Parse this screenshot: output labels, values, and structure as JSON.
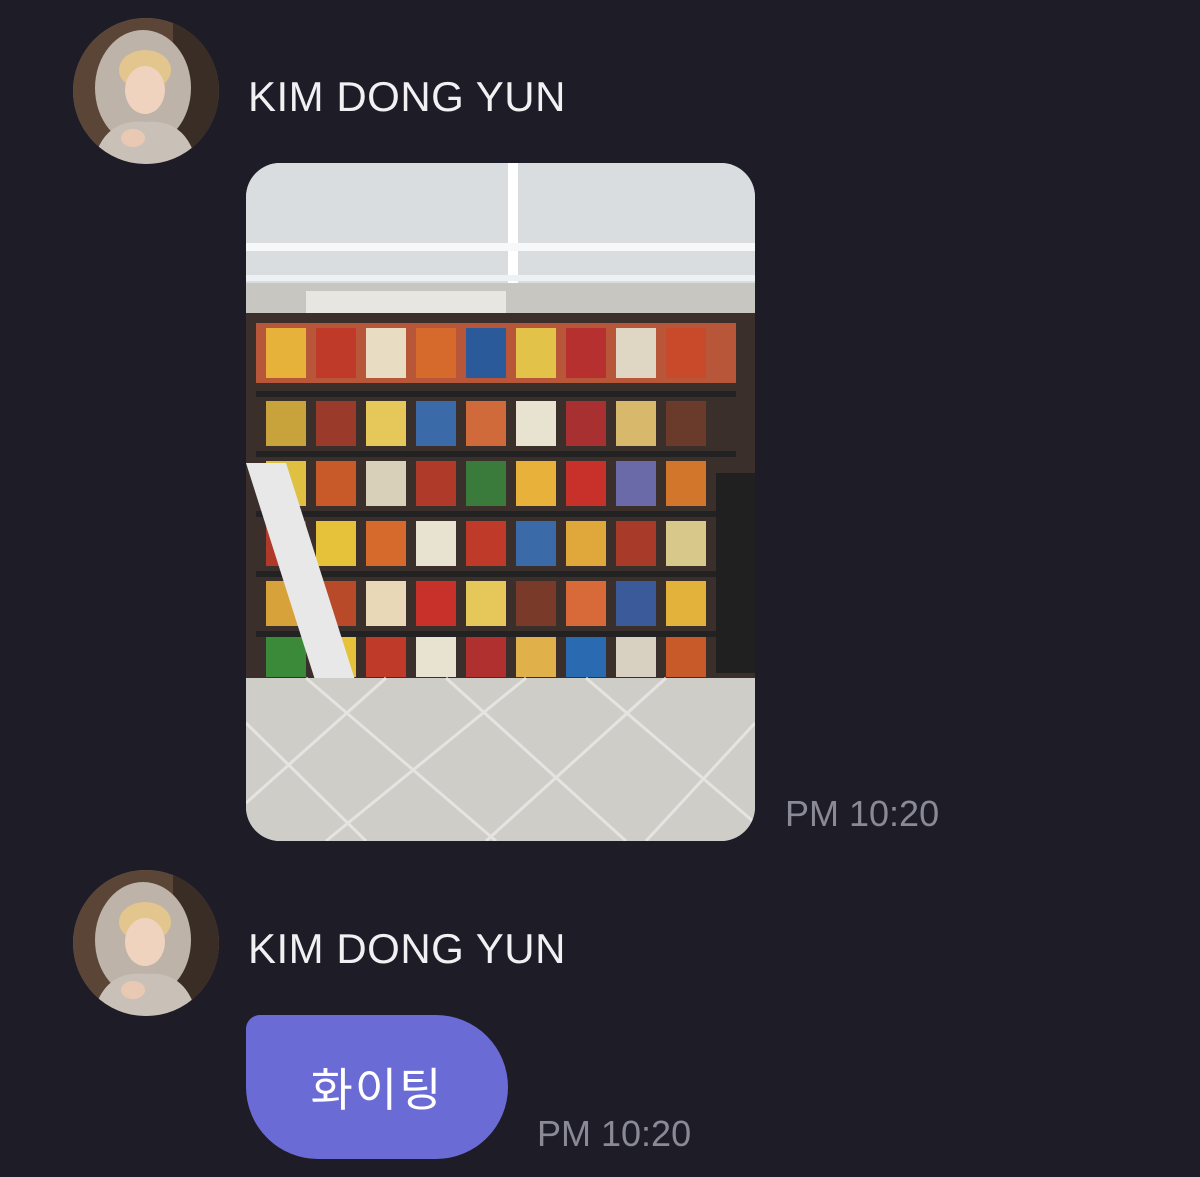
{
  "messages": [
    {
      "sender": "KIM DONG YUN",
      "type": "image",
      "image_icon": "photo-convenience-store-snack-shelves",
      "time": "PM 10:20"
    },
    {
      "sender": "KIM DONG YUN",
      "type": "text",
      "text": "화이팅",
      "time": "PM 10:20"
    }
  ],
  "colors": {
    "background": "#1d1c27",
    "bubble": "#6b6bd6",
    "timestamp": "#8a8a96",
    "sender_text": "#f1f1f4"
  }
}
